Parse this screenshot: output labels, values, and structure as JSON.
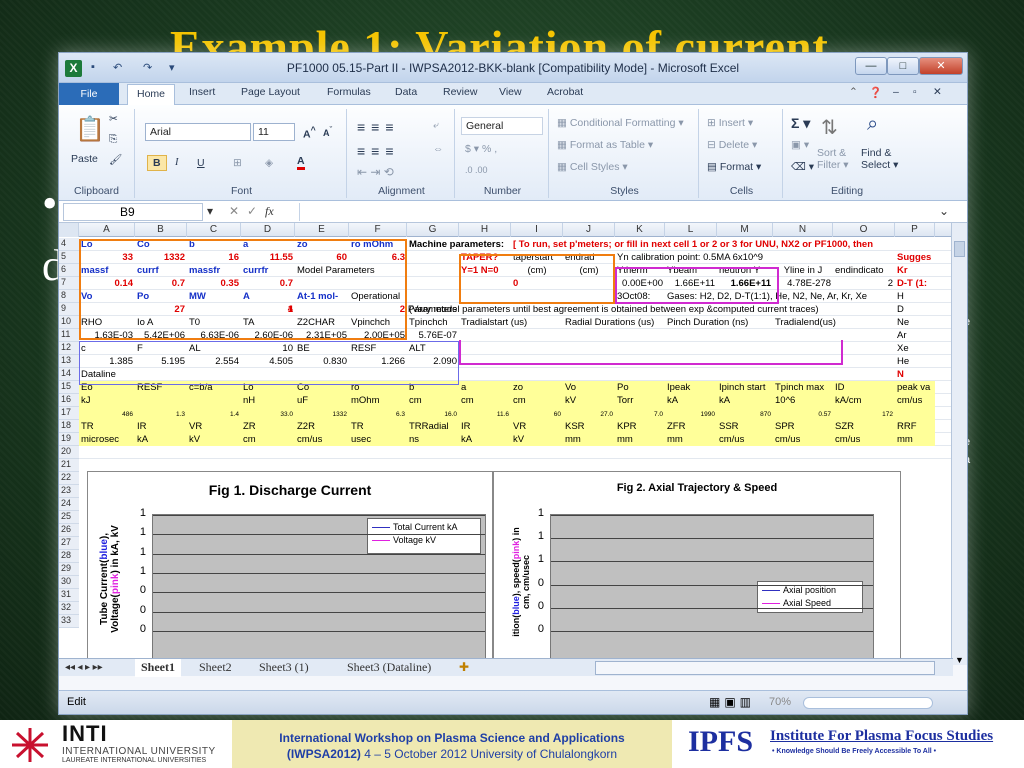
{
  "slide": {
    "title": "Example 1: Variation of current",
    "bullets": [
      "•",
      "d"
    ],
    "peek": [
      "e",
      "e",
      "a"
    ]
  },
  "window": {
    "title": "PF1000 05.15-Part II - IWPSA2012-BKK-blank  [Compatibility Mode] - Microsoft Excel",
    "min": "—",
    "max": "□",
    "close": "✕"
  },
  "ribbon_tabs": [
    "File",
    "Home",
    "Insert",
    "Page Layout",
    "Formulas",
    "Data",
    "Review",
    "View",
    "Acrobat"
  ],
  "ribbon": {
    "font_name": "Arial",
    "font_size": "11",
    "number_format": "General",
    "paste": "Paste",
    "conditional": "Conditional Formatting",
    "format_table": "Format as Table",
    "cell_styles": "Cell Styles",
    "insert": "Insert",
    "delete": "Delete",
    "format": "Format",
    "sort": "Sort &",
    "filter": "Filter",
    "find": "Find &",
    "select": "Select",
    "groups": [
      "Clipboard",
      "Font",
      "Alignment",
      "Number",
      "Styles",
      "Cells",
      "Editing"
    ]
  },
  "formula_bar": {
    "name_box": "B9",
    "fx": "fx",
    "content": ""
  },
  "columns": [
    "A",
    "B",
    "C",
    "D",
    "E",
    "F",
    "G",
    "H",
    "I",
    "J",
    "K",
    "L",
    "M",
    "N",
    "O",
    "P"
  ],
  "rows": [
    4,
    5,
    6,
    7,
    8,
    9,
    10,
    11,
    12,
    13,
    14,
    15,
    16,
    17,
    18,
    19,
    20,
    21,
    22,
    23,
    24,
    25,
    26,
    27,
    28,
    29,
    30,
    31,
    32,
    33
  ],
  "cells": {
    "r4": [
      "Lo",
      "Co",
      "b",
      "a",
      "zo",
      "ro mOhm",
      "Machine parameters:",
      "[ To run, set p'meters; or fill in next cell 1 or 2 or 3 for UNU, NX2 or PF1000, then"
    ],
    "r5": [
      "33",
      "1332",
      "16",
      "11.55",
      "60",
      "6.3"
    ],
    "r5b": [
      "TAPER?",
      "taperstart",
      "endrad",
      "Yn calibration point: 0.5MA 6x10^9",
      "Sugges"
    ],
    "r6": [
      "massf",
      "currf",
      "massfr",
      "currfr",
      "Model Parameters"
    ],
    "r6b": [
      "Y=1 N=0",
      "(cm)",
      "(cm)",
      "Ytherm",
      "Ybeam",
      "neutron Y",
      "Yline in J",
      "endindicato",
      "Kr"
    ],
    "r7": [
      "0.14",
      "0.7",
      "0.35",
      "0.7"
    ],
    "r7b": [
      "0",
      "0.00E+00",
      "1.66E+11",
      "1.66E+11",
      "4.78E-278",
      "2",
      "D-T (1:"
    ],
    "r8": [
      "Vo",
      "Po",
      "MW",
      "A",
      "At-1 mol-",
      "Operational",
      "3Oct08:",
      "Gases: H2, D2, D-T(1:1), He, N2, Ne, Ar, Kr, Xe",
      "H"
    ],
    "r9": [
      "27",
      "4",
      "1",
      "2",
      "Parameters",
      "(Vary model parameters until best agreement is obtained between exp &computed current traces)",
      "D"
    ],
    "r10": [
      "RHO",
      "Io A",
      "T0",
      "TA",
      "Z2CHAR",
      "Vpinchch",
      "Tpinchch",
      "Tradialstart (us)",
      "Radial Durations (us)",
      "Pinch Duration (ns)",
      "Tradialend(us)",
      "Ne"
    ],
    "r11": [
      "1.63E-03",
      "5.42E+06",
      "6.63E-06",
      "2.60E-06",
      "2.31E+05",
      "2.00E+05",
      "5.76E-07",
      "Ar"
    ],
    "r12": [
      "c",
      "F",
      "AL",
      "10",
      "BE",
      "RESF",
      "ALT",
      "Xe"
    ],
    "r13": [
      "1.385",
      "5.195",
      "2.554",
      "4.505",
      "0.830",
      "1.266",
      "2.090",
      "He"
    ],
    "r14": [
      "Dataline",
      "N"
    ],
    "r15": [
      "Eo",
      "RESF",
      "c=b/a",
      "Lo",
      "Co",
      "ro",
      "b",
      "a",
      "zo",
      "Vo",
      "Po",
      "Ipeak",
      "Ipinch start",
      "Tpinch max",
      "ID",
      "peak va"
    ],
    "r16": [
      "kJ",
      "",
      "",
      "nH",
      "uF",
      "mOhm",
      "cm",
      "cm",
      "cm",
      "kV",
      "Torr",
      "kA",
      "kA",
      "10^6",
      "kA/cm",
      "cm/us"
    ],
    "r17": [
      "486",
      "1.3",
      "1.4",
      "33.0",
      "1332",
      "6.3",
      "16.0",
      "11.6",
      "60",
      "27.0",
      "7.0",
      "1990",
      "870",
      "0.57",
      "172"
    ],
    "r18": [
      "TR",
      "IR",
      "VR",
      "ZR",
      "Z2R",
      "TR",
      "TRRadial",
      "IR",
      "VR",
      "KSR",
      "KPR",
      "ZFR",
      "SSR",
      "SPR",
      "SZR",
      "RRF"
    ],
    "r19": [
      "microsec",
      "kA",
      "kV",
      "cm",
      "cm/us",
      "usec",
      "ns",
      "kA",
      "kV",
      "mm",
      "mm",
      "mm",
      "cm/us",
      "cm/us",
      "cm/us",
      "mm"
    ]
  },
  "chart_data": [
    {
      "type": "line",
      "title": "Fig 1. Discharge Current",
      "ylabel_parts": [
        "Tube Current(",
        "blue",
        "),",
        "Voltage(",
        "pink",
        ") in kA, kV"
      ],
      "yticks": [
        "1",
        "1",
        "1",
        "1",
        "0",
        "0",
        "0"
      ],
      "series": [
        {
          "name": "Total Current kA",
          "color": "#3030c0",
          "values": []
        },
        {
          "name": "Voltage kV",
          "color": "#e020e0",
          "values": []
        }
      ],
      "grid": true
    },
    {
      "type": "line",
      "title": "Fig 2. Axial Trajectory & Speed",
      "ylabel_parts": [
        "ition(",
        "blue",
        "), speed(",
        "pink",
        ") in",
        "cm, cm/usec"
      ],
      "yticks": [
        "1",
        "1",
        "1",
        "0",
        "0",
        "0"
      ],
      "series": [
        {
          "name": "Axial position",
          "color": "#3030c0",
          "values": []
        },
        {
          "name": "Axial Speed",
          "color": "#e020e0",
          "values": []
        }
      ],
      "grid": true
    }
  ],
  "sheet_tabs": [
    "Sheet1",
    "Sheet2",
    "Sheet3 (1)",
    "Sheet3 (Dataline)"
  ],
  "status": {
    "mode": "Edit",
    "zoom": "70%"
  },
  "footer": {
    "inti": "INTI",
    "inti_l1": "INTERNATIONAL UNIVERSITY",
    "inti_l2": "LAUREATE INTERNATIONAL UNIVERSITIES",
    "conf_l1": "International Workshop on Plasma Science and Applications",
    "conf_l2a": "(IWPSA2012)",
    "conf_l2b": "4 – 5 October 2012 University of Chulalongkorn",
    "ipfs": "IPFS",
    "ipfs_name": "Institute For Plasma Focus Studies",
    "ipfs_tag": "• Knowledge Should Be Freely Accessible To All •"
  },
  "colors": {
    "orange_box": "#f07d10",
    "magenta_box": "#d02ad0",
    "accent_blue": "#2b6cb8",
    "title_gold": "#f4c400"
  }
}
